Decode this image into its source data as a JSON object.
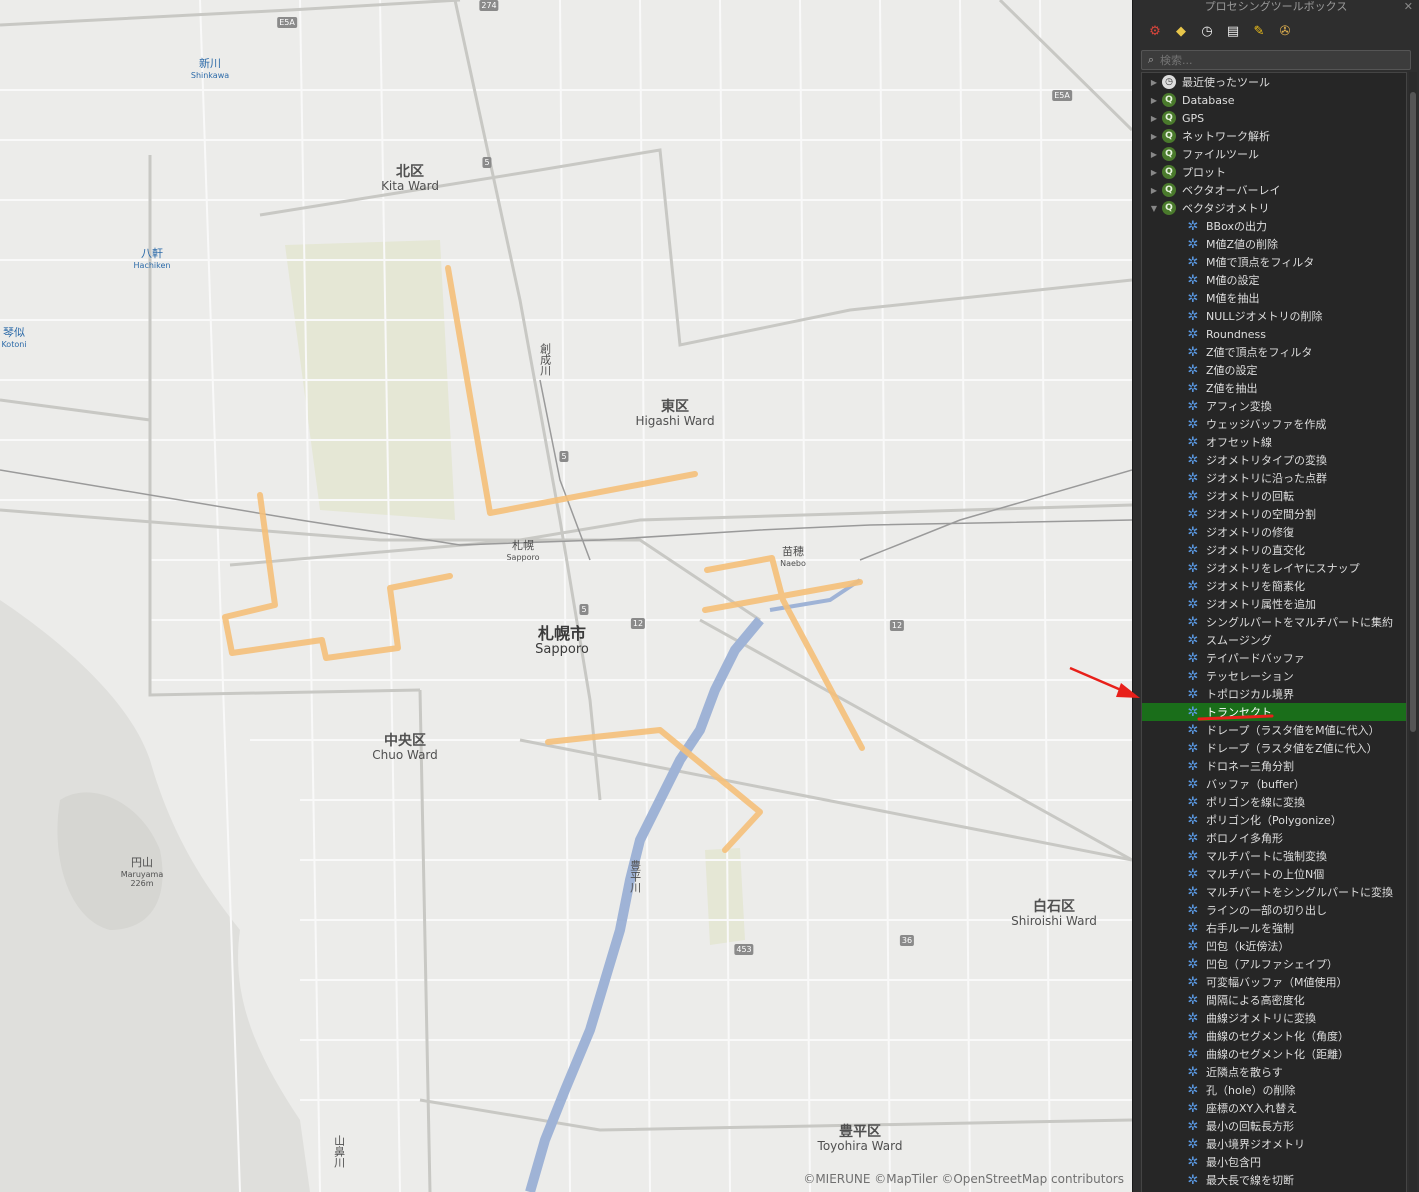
{
  "map": {
    "districts": [
      {
        "jp": "北区",
        "en": "Kita Ward"
      },
      {
        "jp": "東区",
        "en": "Higashi Ward"
      },
      {
        "jp": "中央区",
        "en": "Chuo Ward"
      },
      {
        "jp": "白石区",
        "en": "Shiroishi Ward"
      },
      {
        "jp": "豊平区",
        "en": "Toyohira Ward"
      }
    ],
    "city": {
      "jp": "札幌市",
      "en": "Sapporo"
    },
    "stations": [
      {
        "jp": "新川",
        "en": "Shinkawa"
      },
      {
        "jp": "八軒",
        "en": "Hachiken"
      },
      {
        "jp": "琴似",
        "en": "Kotoni"
      },
      {
        "jp": "札幌",
        "en": "Sapporo"
      },
      {
        "jp": "苗穂",
        "en": "Naebo"
      }
    ],
    "mountain": {
      "jp": "円山",
      "en": "Maruyama",
      "elev": "226m"
    },
    "rivers": [
      "創成川",
      "豊平川",
      "山鼻川"
    ],
    "route_numbers": [
      "274",
      "E5A",
      "5",
      "5",
      "5",
      "12",
      "12",
      "36",
      "453",
      "E5A"
    ],
    "attribution": "©MIERUNE ©MapTiler ©OpenStreetMap contributors",
    "colors": {
      "background": "#ececea",
      "highlight": "#f5c07a",
      "river": "#9fb3d6",
      "park": "#e3e6d2"
    }
  },
  "toolbox": {
    "title": "プロセシングツールボックス",
    "close": "✕",
    "toolbar_icons": [
      "models-icon",
      "python-icon",
      "history-icon",
      "results-icon",
      "edit-features-icon",
      "options-icon"
    ],
    "search_placeholder": "検索...",
    "groups": [
      {
        "label": "最近使ったツール",
        "icon": "clock-icon",
        "expanded": false
      },
      {
        "label": "Database",
        "icon": "qgis-icon",
        "expanded": false
      },
      {
        "label": "GPS",
        "icon": "qgis-icon",
        "expanded": false
      },
      {
        "label": "ネットワーク解析",
        "icon": "qgis-icon",
        "expanded": false
      },
      {
        "label": "ファイルツール",
        "icon": "qgis-icon",
        "expanded": false
      },
      {
        "label": "プロット",
        "icon": "qgis-icon",
        "expanded": false
      },
      {
        "label": "ベクタオーバーレイ",
        "icon": "qgis-icon",
        "expanded": false
      },
      {
        "label": "ベクタジオメトリ",
        "icon": "qgis-icon",
        "expanded": true
      }
    ],
    "algorithms": [
      "BBoxの出力",
      "M値Z値の削除",
      "M値で頂点をフィルタ",
      "M値の設定",
      "M値を抽出",
      "NULLジオメトリの削除",
      "Roundness",
      "Z値で頂点をフィルタ",
      "Z値の設定",
      "Z値を抽出",
      "アフィン変換",
      "ウェッジバッファを作成",
      "オフセット線",
      "ジオメトリタイプの変換",
      "ジオメトリに沿った点群",
      "ジオメトリの回転",
      "ジオメトリの空間分割",
      "ジオメトリの修復",
      "ジオメトリの直交化",
      "ジオメトリをレイヤにスナップ",
      "ジオメトリを簡素化",
      "ジオメトリ属性を追加",
      "シングルパートをマルチパートに集約",
      "スムージング",
      "テイパードバッファ",
      "テッセレーション",
      "トポロジカル境界",
      "トランセクト",
      "ドレープ（ラスタ値をM値に代入）",
      "ドレープ（ラスタ値をZ値に代入）",
      "ドロネー三角分割",
      "バッファ（buffer）",
      "ポリゴンを線に変換",
      "ポリゴン化（Polygonize）",
      "ボロノイ多角形",
      "マルチパートに強制変換",
      "マルチパートの上位N個",
      "マルチパートをシングルパートに変換",
      "ラインの一部の切り出し",
      "右手ルールを強制",
      "凹包（k近傍法）",
      "凹包（アルファシェイプ）",
      "可変幅バッファ（M値使用）",
      "間隔による高密度化",
      "曲線ジオメトリに変換",
      "曲線のセグメント化（角度）",
      "曲線のセグメント化（距離）",
      "近隣点を散らす",
      "孔（hole）の削除",
      "座標のXY入れ替え",
      "最小の回転長方形",
      "最小境界ジオメトリ",
      "最小包含円",
      "最大長で線を切断"
    ],
    "selected": "トランセクト",
    "colors": {
      "selected": "#1a6e1a",
      "annotation": "#e8201a"
    }
  }
}
